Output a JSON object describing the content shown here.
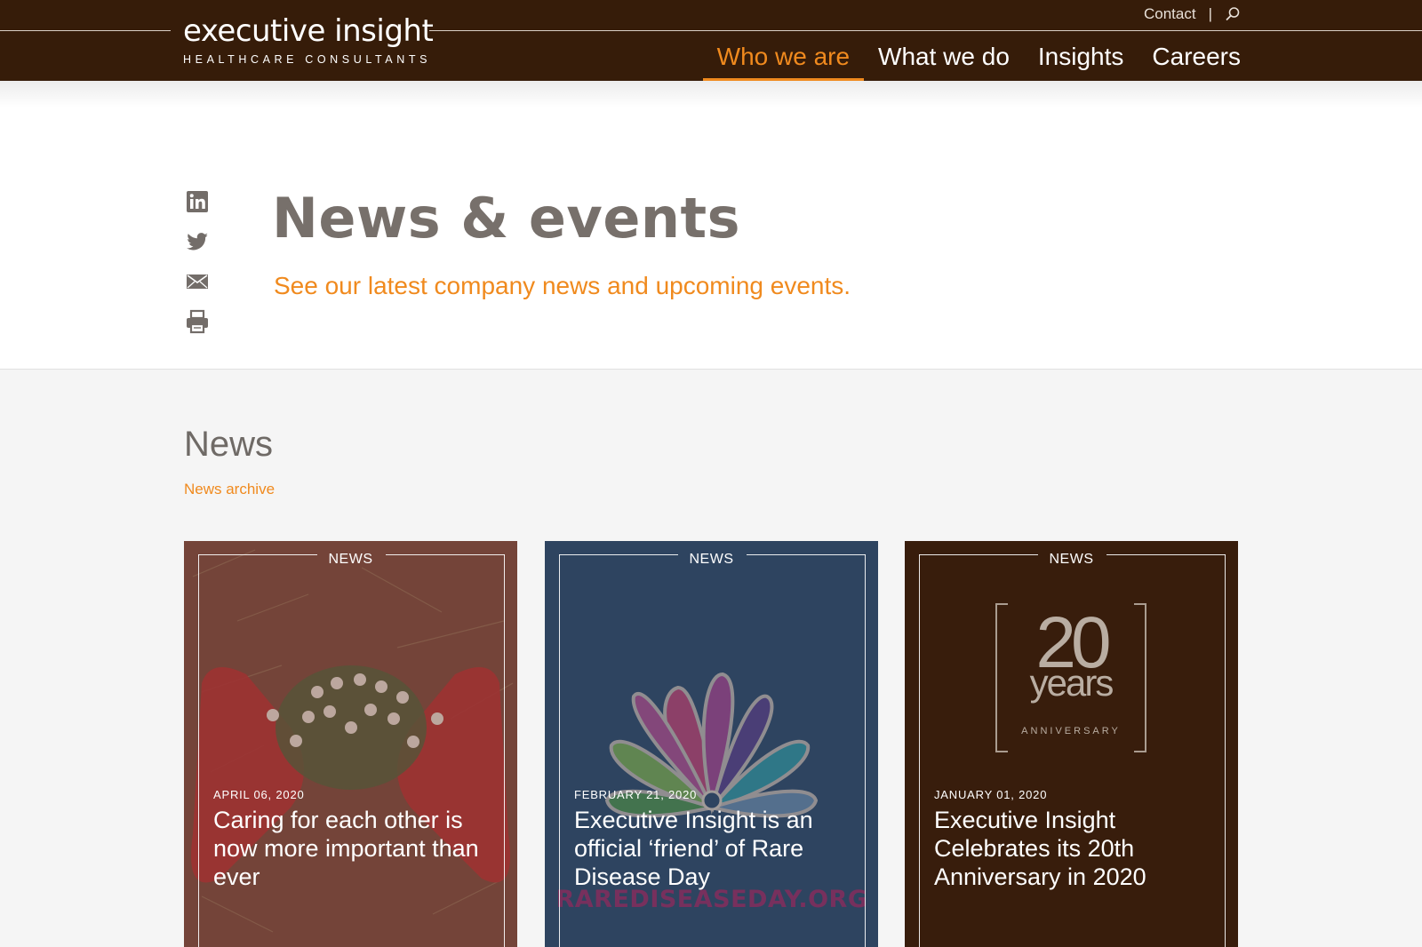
{
  "header": {
    "logo_name": "executive insight",
    "logo_tagline": "HEALTHCARE CONSULTANTS",
    "contact_label": "Contact",
    "separator": "|",
    "nav": [
      {
        "label": "Who we are",
        "active": true
      },
      {
        "label": "What we do",
        "active": false
      },
      {
        "label": "Insights",
        "active": false
      },
      {
        "label": "Careers",
        "active": false
      }
    ]
  },
  "hero": {
    "title": "News & events",
    "subtitle": "See our latest company news and upcoming events."
  },
  "social": [
    "linkedin-icon",
    "twitter-icon",
    "email-icon",
    "print-icon"
  ],
  "news": {
    "heading": "News",
    "archive_link": "News archive",
    "cards": [
      {
        "label": "NEWS",
        "date": "APRIL 06, 2020",
        "title": "Caring for each other is now more important than ever"
      },
      {
        "label": "NEWS",
        "date": "FEBRUARY 21, 2020",
        "title": "Executive Insight is an official ‘friend’ of Rare Disease Day",
        "image_text": "RAREDISEASEDAY.ORG"
      },
      {
        "label": "NEWS",
        "date": "JANUARY 01, 2020",
        "title": "Executive Insight Celebrates its 20th Anniversary in 2020",
        "badge_number": "20",
        "badge_word": "years",
        "badge_caption": "ANNIVERSARY"
      }
    ]
  },
  "colors": {
    "header_bg": "#361c09",
    "accent": "#f08a1e",
    "title_gray": "#77706b",
    "card_blue": "#2e4560",
    "card_brown": "#381d0c"
  }
}
